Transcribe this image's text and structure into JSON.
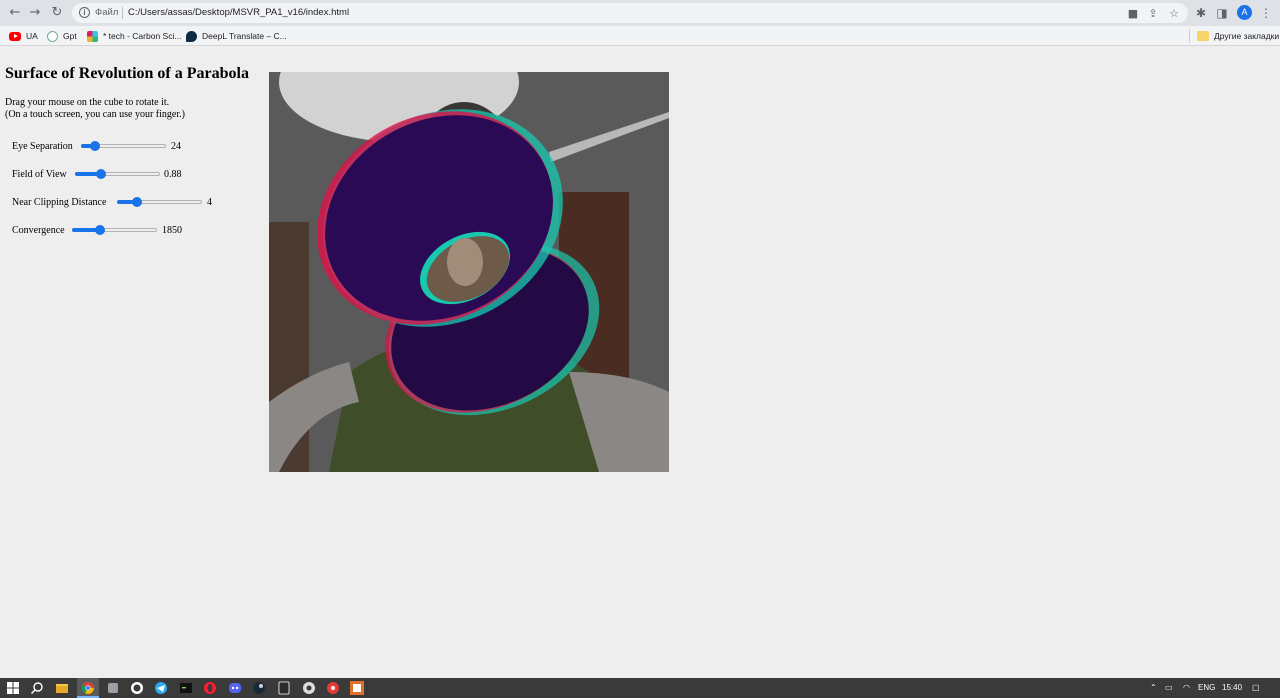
{
  "browser": {
    "scheme_label": "Файл",
    "url": "C:/Users/assas/Desktop/MSVR_PA1_v16/index.html",
    "profile_initial": "A",
    "bookmarks": [
      {
        "label": "UA",
        "icon": "youtube-icon"
      },
      {
        "label": "Gpt",
        "icon": "openai-icon"
      },
      {
        "label": "* tech - Carbon Sci...",
        "icon": "slack-icon"
      },
      {
        "label": "DeepL Translate – C...",
        "icon": "deepl-icon"
      }
    ],
    "other_bookmarks": "Другие закладки"
  },
  "page": {
    "title": "Surface of Revolution of a Parabola",
    "instructions": [
      "Drag your mouse on the cube to rotate it.",
      "(On a touch screen, you can use your finger.)"
    ],
    "controls": [
      {
        "label": "Eye Separation",
        "value": "24",
        "level": 0.12
      },
      {
        "label": "Field of View",
        "value": "0.88",
        "level": 0.28
      },
      {
        "label": "Near Clipping Distance",
        "value": "4",
        "level": 0.2
      },
      {
        "label": "Convergence",
        "value": "1850",
        "level": 0.3
      }
    ]
  },
  "taskbar": {
    "language": "ENG",
    "time": "15:40"
  },
  "colors": {
    "accent": "#1a73e8",
    "anaglyph_red": "#e0104a",
    "anaglyph_cyan": "#18c9b0",
    "surface_fill": "#2a0a55"
  }
}
